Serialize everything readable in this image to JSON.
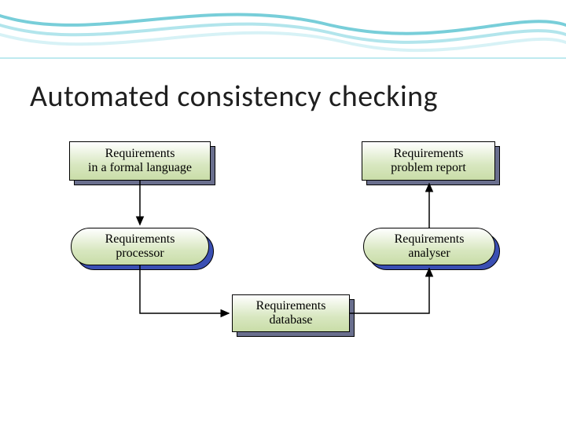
{
  "title": "Automated consistency checking",
  "nodes": {
    "req_formal": {
      "line1": "Requirements",
      "line2": "in a formal language"
    },
    "req_report": {
      "line1": "Requirements",
      "line2": "problem report"
    },
    "req_processor": {
      "line1": "Requirements",
      "line2": "processor"
    },
    "req_analyser": {
      "line1": "Requirements",
      "line2": "analyser"
    },
    "req_database": {
      "line1": "Requirements",
      "line2": "database"
    }
  }
}
